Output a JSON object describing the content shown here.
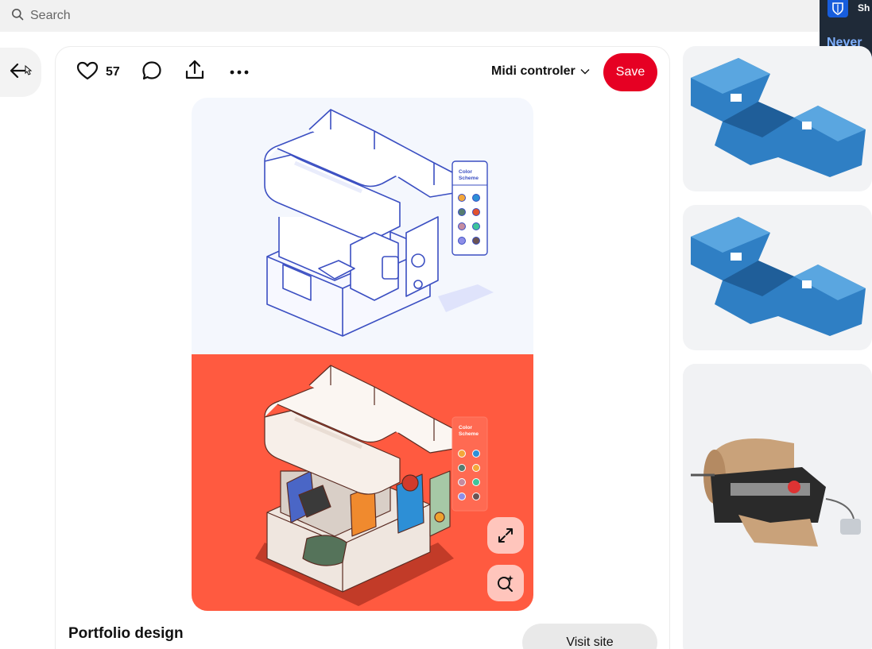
{
  "search": {
    "placeholder": "Search"
  },
  "popup": {
    "title_partial": "Sh",
    "never_label": "Never"
  },
  "pin": {
    "like_count": "57",
    "board_name": "Midi controler",
    "save_label": "Save",
    "title": "Portfolio design",
    "visit_label": "Visit site",
    "image_text": {
      "color_scheme_line1": "Color",
      "color_scheme_line2": "Scheme"
    }
  },
  "colors": {
    "brand_red": "#e60023",
    "pin_bg_top": "#f4f7fd",
    "pin_bg_bottom": "#ff5a40",
    "outline_blue": "#3b4fc2"
  },
  "icons": [
    "search-icon",
    "back-arrow-icon",
    "heart-icon",
    "comment-icon",
    "share-icon",
    "more-icon",
    "chevron-down-icon",
    "expand-icon",
    "visual-search-icon",
    "shield-icon"
  ]
}
